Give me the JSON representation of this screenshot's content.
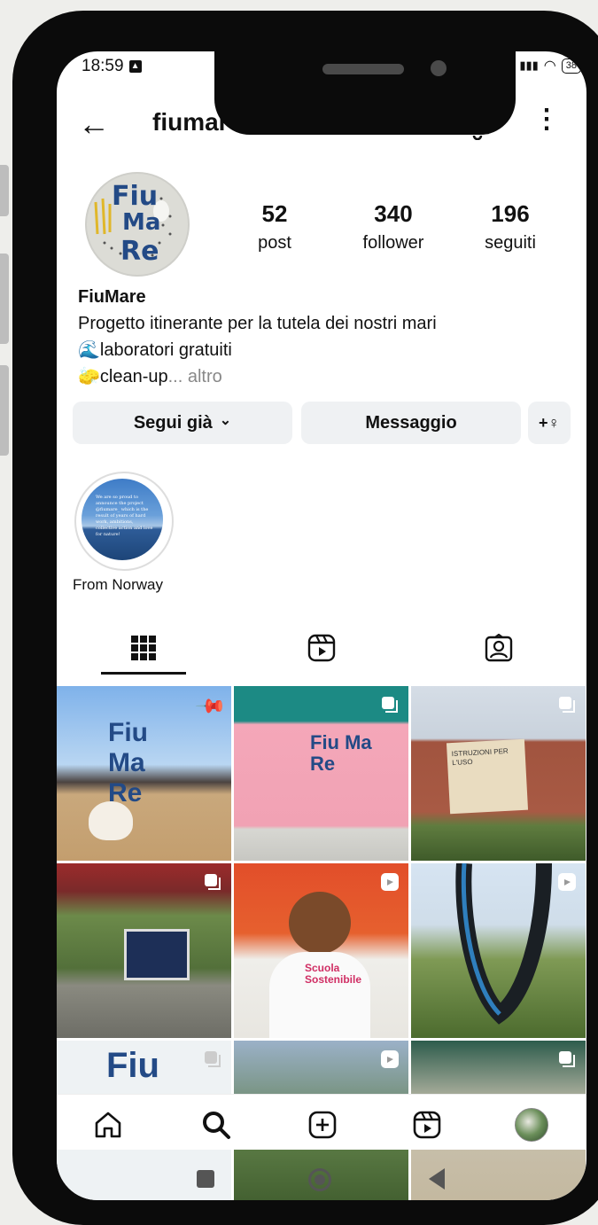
{
  "status": {
    "time": "18:59",
    "battery": "38"
  },
  "header": {
    "username": "fiumare_"
  },
  "avatar": {
    "logo_lines": [
      "Fiu",
      "Ma",
      "Re"
    ]
  },
  "stats": [
    {
      "count": "52",
      "label": "post"
    },
    {
      "count": "340",
      "label": "follower"
    },
    {
      "count": "196",
      "label": "seguiti"
    }
  ],
  "bio": {
    "name": "FiuMare",
    "line1": "Progetto itinerante per la tutela dei nostri mari",
    "line2_icon": "🌊",
    "line2": "laboratori gratuiti",
    "line3_icon": "🧽",
    "line3": "clean-up",
    "more": "... altro"
  },
  "actions": {
    "follow": "Segui già",
    "follow_chevron": "⌄",
    "message": "Messaggio",
    "add_user_icon": "+♀"
  },
  "highlights": [
    {
      "label": "From Norway",
      "text": "We are so proud to announce the project @fiumare_ which is the result of years of hard work, ambitions, collective action and love for nature!"
    }
  ],
  "tabs": [
    "grid-icon",
    "reels-icon",
    "tagged-icon"
  ],
  "posts": [
    {
      "type": "pinned",
      "label": "Fiu Ma Re"
    },
    {
      "type": "carousel",
      "label": "Fiu Ma Re"
    },
    {
      "type": "carousel",
      "label": "ISTRUZIONI PER L'USO"
    },
    {
      "type": "carousel",
      "label": ""
    },
    {
      "type": "reel",
      "label": "Scuola Sostenibile"
    },
    {
      "type": "reel",
      "label": ""
    },
    {
      "type": "carousel",
      "label": "Fiu"
    },
    {
      "type": "reel",
      "label": ""
    },
    {
      "type": "carousel",
      "label": ""
    }
  ],
  "bottom_nav": [
    "home-icon",
    "search-icon",
    "create-icon",
    "reels-icon",
    "profile-icon"
  ],
  "colors": {
    "accent": "#234a86",
    "button_bg": "#eff1f3"
  }
}
